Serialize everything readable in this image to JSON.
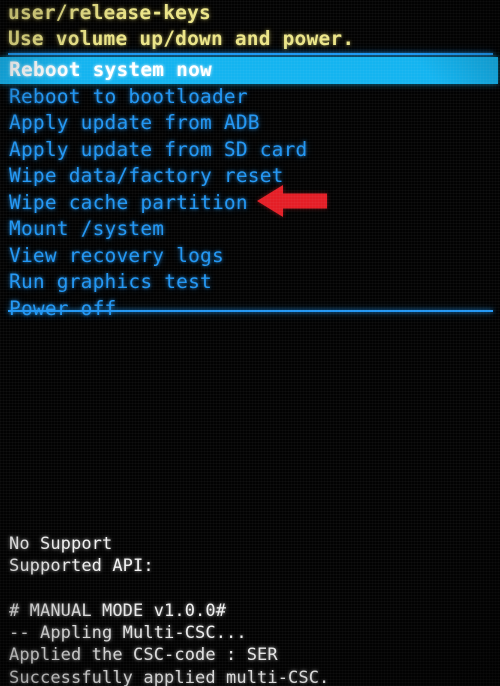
{
  "screen": {
    "title": "Android Recovery Mode",
    "background_color": "#000000",
    "noise": "camera-photo-of-phone-screen"
  },
  "header": {
    "build_line": "user/release-keys",
    "instruction_line": "Use volume up/down and power.",
    "color": "#ece587"
  },
  "menu": {
    "text_color": "#2196f3",
    "selected_background": "#14b4f0",
    "selected_text_color": "#ffffff",
    "selected_index": 0,
    "items": [
      {
        "label": "Reboot system now",
        "selected": true
      },
      {
        "label": "Reboot to bootloader",
        "selected": false
      },
      {
        "label": "Apply update from ADB",
        "selected": false
      },
      {
        "label": "Apply update from SD card",
        "selected": false
      },
      {
        "label": "Wipe data/factory reset",
        "selected": false
      },
      {
        "label": "Wipe cache partition",
        "selected": false
      },
      {
        "label": "Mount /system",
        "selected": false
      },
      {
        "label": "View recovery logs",
        "selected": false
      },
      {
        "label": "Run graphics test",
        "selected": false
      },
      {
        "label": "Power off",
        "selected": false
      }
    ]
  },
  "annotation": {
    "arrow_color": "#e41e26",
    "arrow_direction": "left",
    "points_at": "Wipe cache partition"
  },
  "log": {
    "text_color": "#f2f2f2",
    "lines": [
      "No Support",
      "Supported API:",
      "",
      "# MANUAL MODE v1.0.0#",
      "-- Appling Multi-CSC...",
      "Applied the CSC-code : SER",
      "Successfully applied multi-CSC."
    ]
  }
}
